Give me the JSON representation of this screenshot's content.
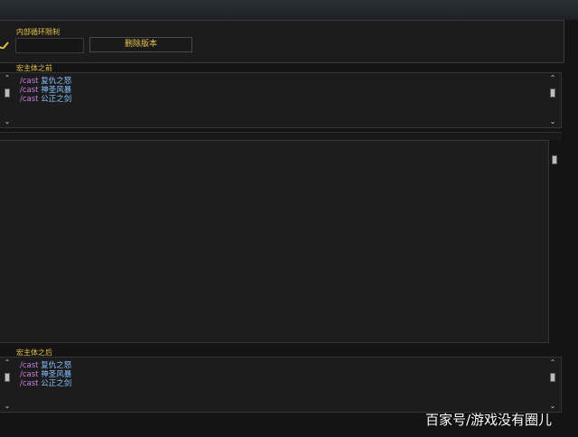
{
  "header": {
    "inner_loop_label": "内部循环限制",
    "inner_loop_value": "",
    "delete_button": "删除版本"
  },
  "macro_before": {
    "label": "宏主体之前",
    "lines": [
      {
        "cmd": "/cast",
        "spell": "复仇之怒"
      },
      {
        "cmd": "/cast",
        "spell": "神圣风暴"
      },
      {
        "cmd": "/cast",
        "spell": "公正之剑"
      }
    ]
  },
  "macro_after": {
    "label": "宏主体之后",
    "lines": [
      {
        "cmd": "/cast",
        "spell": "复仇之怒"
      },
      {
        "cmd": "/cast",
        "spell": "神圣风暴"
      },
      {
        "cmd": "/cast",
        "spell": "公正之剑"
      }
    ]
  },
  "watermark": "百家号/游戏没有圈儿",
  "colors": {
    "label": "#e8c14a",
    "command": "#c87ee0",
    "spell": "#88c0ff"
  },
  "icons": {
    "up": "scroll-up-icon",
    "down": "scroll-down-icon",
    "check": "checkmark-icon"
  }
}
